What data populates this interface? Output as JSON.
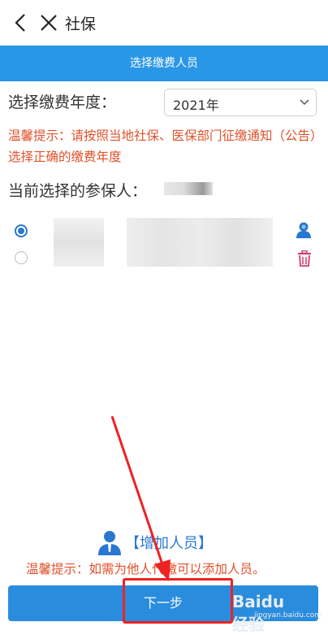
{
  "header": {
    "title": "社保"
  },
  "subheader": {
    "title": "选择缴费人员"
  },
  "year": {
    "label": "选择缴费年度：",
    "selected": "2021年"
  },
  "tip": {
    "text": "温馨提示：请按照当地社保、医保部门征缴通知（公告）选择正确的缴费年度"
  },
  "current": {
    "label": "当前选择的参保人："
  },
  "add": {
    "label": "【增加人员】"
  },
  "bottom_tip": {
    "text": "温馨提示：如需为他人代缴可以添加人员。"
  },
  "next_button": {
    "label": "下一步"
  },
  "watermark": {
    "text": "Baidu经验",
    "sub": "jingyan.baidu.com"
  },
  "colors": {
    "accent": "#2a97e6",
    "warning": "#e0512a",
    "button": "#2a8cdd",
    "annotation": "#e22"
  }
}
